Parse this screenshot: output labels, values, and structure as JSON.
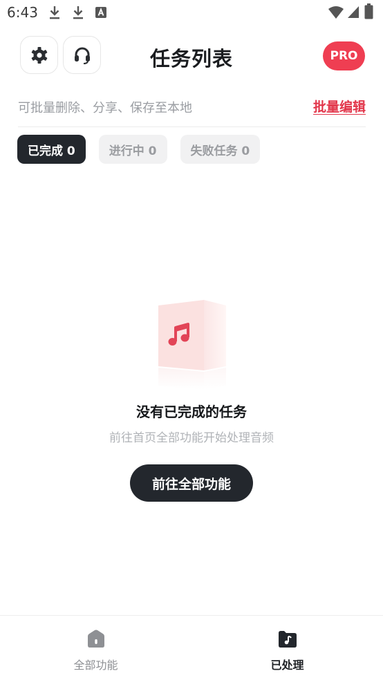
{
  "status_bar": {
    "time": "6:43",
    "left_icons": [
      "download-icon",
      "download-icon",
      "font-a-icon"
    ],
    "right_icons": [
      "wifi-icon",
      "cellular-signal-icon",
      "battery-icon"
    ]
  },
  "header": {
    "title": "任务列表",
    "left_buttons": [
      "gear-icon",
      "headset-icon"
    ],
    "pro_label": "PRO"
  },
  "info_row": {
    "hint": "可批量删除、分享、保存至本地",
    "batch_edit_label": "批量编辑"
  },
  "tabs": [
    {
      "label": "已完成 0",
      "active": true
    },
    {
      "label": "进行中 0",
      "active": false
    },
    {
      "label": "失败任务 0",
      "active": false
    }
  ],
  "empty_state": {
    "icon": "music-note-icon",
    "title": "没有已完成的任务",
    "subtitle": "前往首页全部功能开始处理音频",
    "button_label": "前往全部功能"
  },
  "bottom_nav": {
    "items": [
      {
        "label": "全部功能",
        "icon": "home-icon",
        "active": false
      },
      {
        "label": "已处理",
        "icon": "music-folder-icon",
        "active": true
      }
    ]
  },
  "colors": {
    "accent": "#ef3e52",
    "link": "#e2364b",
    "dark": "#23272d"
  }
}
